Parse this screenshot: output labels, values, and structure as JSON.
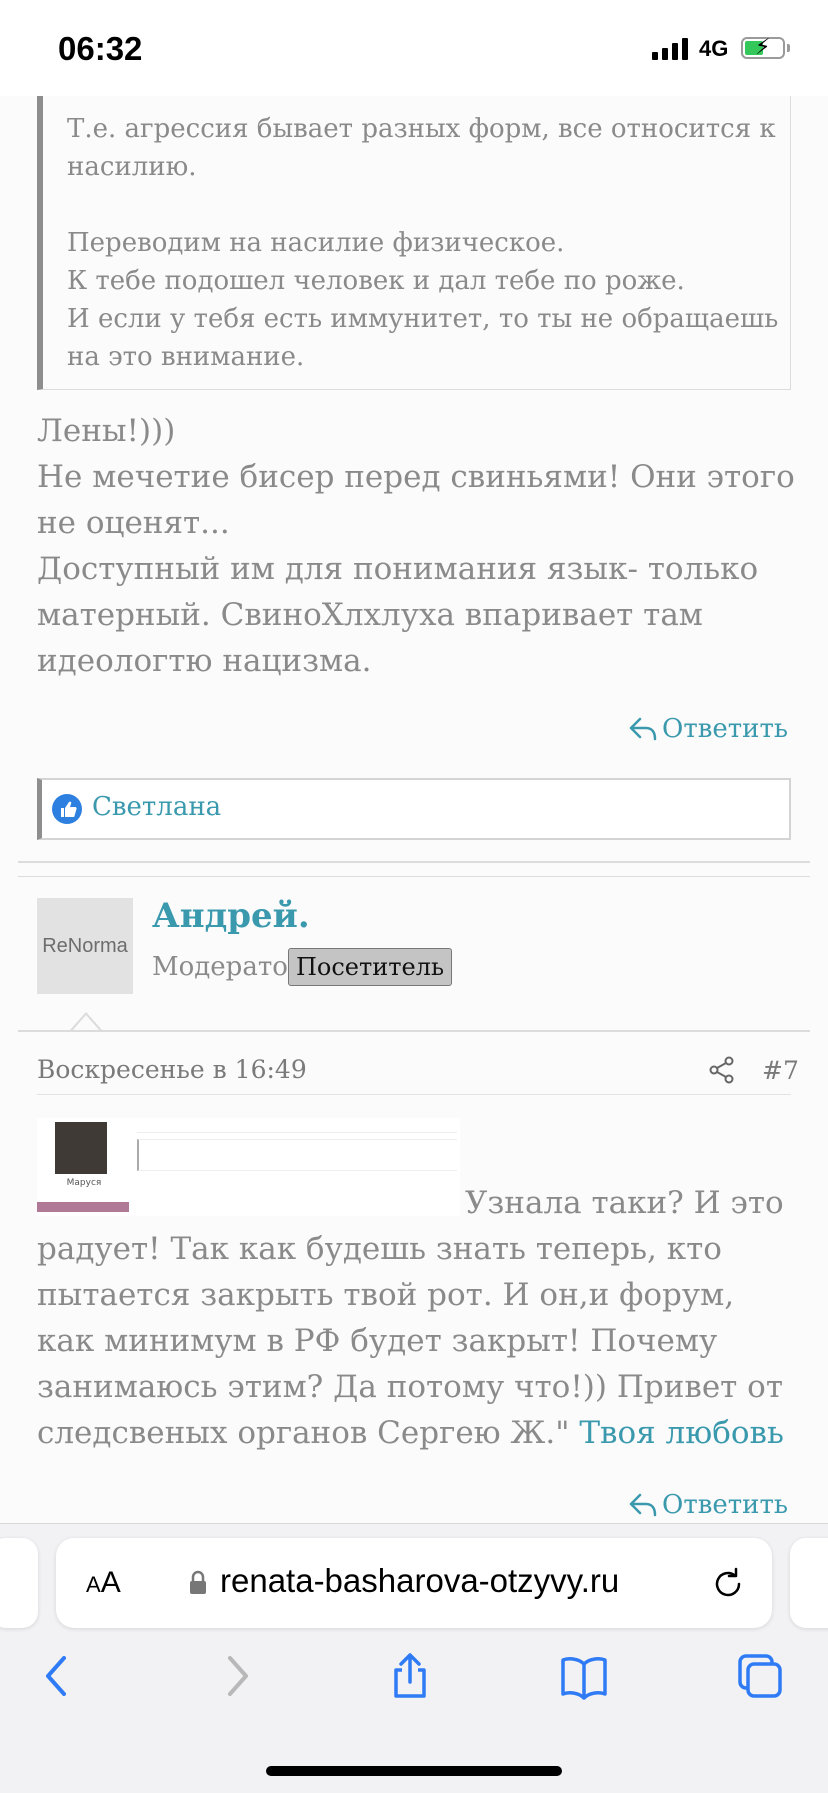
{
  "status": {
    "time": "06:32",
    "network": "4G"
  },
  "quote": {
    "text": "Т.е. агрессия бывает разных форм, все относится к насилию.\n\nПереводим на насилие физическое.\nК тебе подошел человек и дал тебе по роже.\nИ если у тебя есть иммунитет, то ты не обращаешь на это внимание."
  },
  "post1": {
    "text": "Лены!)))\nНе мечетие бисер перед свиньями! Они этого не оценят...\nДоступный им для понимания язык- только матерный. СвиноХлхлуха впаривает там идеологтю нацизма.",
    "reply_label": "Ответить",
    "like_name": "Светлана"
  },
  "post2": {
    "avatar_text": "ReNorma",
    "author": "Андрей.",
    "role": "Модератор",
    "badge": "Посетитель",
    "date": "Воскресенье в 16:49",
    "number": "#7",
    "thumb_caption": "Маруся",
    "text": "Узнала таки? И это радует! Так как будешь знать теперь, кто пытается закрыть твой рот. И он,и форум, как минимум в РФ будет закрыт! Почему занимаюсь этим? Да потому что!)) Привет от следсвеных органов Сергею Ж.\" ",
    "link": "Твоя любовь",
    "reply_label": "Ответить"
  },
  "browser": {
    "aa_label": "AA",
    "url": "renata-basharova-otzyvy.ru"
  },
  "colors": {
    "link": "#3a99ad",
    "text": "#8a8a8a",
    "like": "#2d7fe0"
  }
}
